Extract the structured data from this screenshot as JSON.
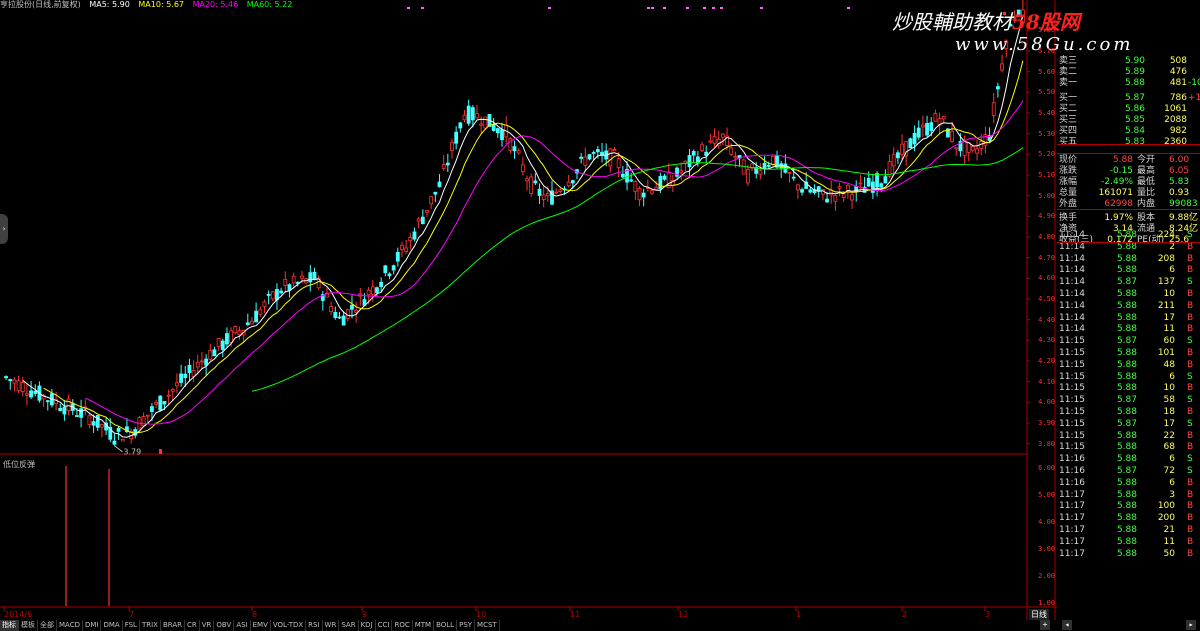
{
  "ma_legend": {
    "title": "亨拉股份(日线,前复权)",
    "items": [
      {
        "label": "MA5: 5.90",
        "color": "#ffffff"
      },
      {
        "label": "MA10: 5.67",
        "color": "#ffff00"
      },
      {
        "label": "MA20: 5.46",
        "color": "#ff00ff"
      },
      {
        "label": "MA60: 5.22",
        "color": "#00ff00"
      }
    ]
  },
  "watermark": {
    "main": "炒股輔助教材",
    "brand": "58股网",
    "url": "www.58Gu.com"
  },
  "price_axis": {
    "labels": [
      "5.80",
      "5.70",
      "5.60",
      "5.50",
      "5.40",
      "5.30",
      "5.20",
      "5.10",
      "5.00",
      "4.90",
      "4.80",
      "4.70",
      "4.60",
      "4.50",
      "4.40",
      "4.30",
      "4.20",
      "4.10",
      "4.00",
      "3.90",
      "3.80"
    ]
  },
  "low_marker": "3.79",
  "indicator": {
    "title": "低位反弹",
    "axis_labels": [
      "6.00",
      "5.00",
      "4.00",
      "3.00",
      "2.00",
      "1.00"
    ]
  },
  "x_axis": {
    "labels": [
      "2014/6",
      "7",
      "8",
      "9",
      "10",
      "11",
      "12",
      "1",
      "2",
      "3"
    ]
  },
  "period_label": "日线",
  "order_book": [
    {
      "label": "卖三",
      "price": "5.90",
      "vol": "508",
      "chg": ""
    },
    {
      "label": "卖二",
      "price": "5.89",
      "vol": "476",
      "chg": ""
    },
    {
      "label": "卖一",
      "price": "5.88",
      "vol": "481",
      "chg": "-10"
    },
    {
      "label": "买一",
      "price": "5.87",
      "vol": "786",
      "chg": "+10"
    },
    {
      "label": "买二",
      "price": "5.86",
      "vol": "1061",
      "chg": ""
    },
    {
      "label": "买三",
      "price": "5.85",
      "vol": "2088",
      "chg": ""
    },
    {
      "label": "买四",
      "price": "5.84",
      "vol": "982",
      "chg": ""
    },
    {
      "label": "买五",
      "price": "5.83",
      "vol": "2360",
      "chg": ""
    }
  ],
  "quote": [
    {
      "l1": "现价",
      "v1": "5.88",
      "c1": "#ff4444",
      "l2": "今开",
      "v2": "6.00",
      "c2": "#ff4444"
    },
    {
      "l1": "涨跌",
      "v1": "-0.15",
      "c1": "#44ff44",
      "l2": "最高",
      "v2": "6.05",
      "c2": "#ff4444"
    },
    {
      "l1": "涨幅",
      "v1": "-2.49%",
      "c1": "#44ff44",
      "l2": "最低",
      "v2": "5.83",
      "c2": "#44ff44"
    },
    {
      "l1": "总量",
      "v1": "161071",
      "c1": "#ffff66",
      "l2": "量比",
      "v2": "0.93",
      "c2": "#ffff66"
    },
    {
      "l1": "外盘",
      "v1": "62998",
      "c1": "#ff4444",
      "l2": "内盘",
      "v2": "99083",
      "c2": "#44ff44"
    },
    {
      "l1": "换手",
      "v1": "1.97%",
      "c1": "#ffff66",
      "l2": "股本",
      "v2": "9.88亿",
      "c2": "#ffff66"
    },
    {
      "l1": "净资",
      "v1": "3.14",
      "c1": "#ffff66",
      "l2": "流通",
      "v2": "8.24亿",
      "c2": "#ffff66"
    },
    {
      "l1": "收益(三)",
      "v1": "0.172",
      "c1": "#ffff66",
      "l2": "PE(动)",
      "v2": "25.6",
      "c2": "#ffff66"
    }
  ],
  "ticks": [
    {
      "time": "11:14",
      "price": "5.88",
      "vol": "224",
      "side": "S"
    },
    {
      "time": "11:14",
      "price": "5.88",
      "vol": "2",
      "side": "B"
    },
    {
      "time": "11:14",
      "price": "5.88",
      "vol": "208",
      "side": "B"
    },
    {
      "time": "11:14",
      "price": "5.88",
      "vol": "6",
      "side": "B"
    },
    {
      "time": "11:14",
      "price": "5.87",
      "vol": "137",
      "side": "S"
    },
    {
      "time": "11:14",
      "price": "5.88",
      "vol": "10",
      "side": "B"
    },
    {
      "time": "11:14",
      "price": "5.88",
      "vol": "211",
      "side": "B"
    },
    {
      "time": "11:14",
      "price": "5.88",
      "vol": "17",
      "side": "B"
    },
    {
      "time": "11:14",
      "price": "5.88",
      "vol": "11",
      "side": "B"
    },
    {
      "time": "11:15",
      "price": "5.87",
      "vol": "60",
      "side": "S"
    },
    {
      "time": "11:15",
      "price": "5.88",
      "vol": "101",
      "side": "B"
    },
    {
      "time": "11:15",
      "price": "5.88",
      "vol": "48",
      "side": "B"
    },
    {
      "time": "11:15",
      "price": "5.88",
      "vol": "6",
      "side": "S"
    },
    {
      "time": "11:15",
      "price": "5.88",
      "vol": "10",
      "side": "B"
    },
    {
      "time": "11:15",
      "price": "5.87",
      "vol": "58",
      "side": "S"
    },
    {
      "time": "11:15",
      "price": "5.88",
      "vol": "18",
      "side": "B"
    },
    {
      "time": "11:15",
      "price": "5.87",
      "vol": "17",
      "side": "S"
    },
    {
      "time": "11:15",
      "price": "5.88",
      "vol": "22",
      "side": "B"
    },
    {
      "time": "11:15",
      "price": "5.88",
      "vol": "68",
      "side": "B"
    },
    {
      "time": "11:16",
      "price": "5.88",
      "vol": "6",
      "side": "S"
    },
    {
      "time": "11:16",
      "price": "5.87",
      "vol": "72",
      "side": "S"
    },
    {
      "time": "11:16",
      "price": "5.88",
      "vol": "6",
      "side": "B"
    },
    {
      "time": "11:17",
      "price": "5.88",
      "vol": "3",
      "side": "B"
    },
    {
      "time": "11:17",
      "price": "5.88",
      "vol": "100",
      "side": "B"
    },
    {
      "time": "11:17",
      "price": "5.88",
      "vol": "200",
      "side": "B"
    },
    {
      "time": "11:17",
      "price": "5.88",
      "vol": "21",
      "side": "B"
    },
    {
      "time": "11:17",
      "price": "5.88",
      "vol": "11",
      "side": "B"
    },
    {
      "time": "11:17",
      "price": "5.88",
      "vol": "50",
      "side": "B"
    }
  ],
  "tabs": [
    "指标",
    "模板",
    "全部",
    "MACD",
    "DMI",
    "DMA",
    "FSL",
    "TRIX",
    "BRAR",
    "CR",
    "VR",
    "OBV",
    "ASI",
    "EMV",
    "VOL-TDX",
    "RSI",
    "WR",
    "SAR",
    "KDJ",
    "CCI",
    "ROC",
    "MTM",
    "BOLL",
    "PSY",
    "MCST"
  ],
  "colors": {
    "up": "#ff3333",
    "down": "#44ffff",
    "ma5": "#ffffff",
    "ma10": "#ffff00",
    "ma20": "#ff00ff",
    "ma60": "#00ff00",
    "grid": "#b00000"
  },
  "chart_data": {
    "type": "candlestick",
    "ylim": [
      3.75,
      5.85
    ],
    "low_point": 3.79,
    "recent": {
      "open": 6.0,
      "high": 6.05,
      "low": 5.83,
      "close": 5.88
    }
  }
}
